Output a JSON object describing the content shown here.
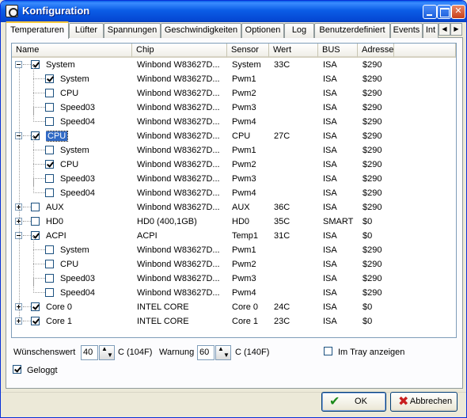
{
  "window": {
    "title": "Konfiguration"
  },
  "tabs": [
    {
      "label": "Temperaturen",
      "active": true
    },
    {
      "label": "Lüfter"
    },
    {
      "label": "Spannungen"
    },
    {
      "label": "Geschwindigkeiten"
    },
    {
      "label": "Optionen"
    },
    {
      "label": "Log"
    },
    {
      "label": "Benutzerdefiniert"
    },
    {
      "label": "Events"
    },
    {
      "label": "Int"
    }
  ],
  "table": {
    "columns": [
      "Name",
      "Chip",
      "Sensor",
      "Wert",
      "BUS",
      "Adresse"
    ],
    "rows": [
      {
        "level": 0,
        "expander": "minus",
        "checked": true,
        "name": "System",
        "chip": "Winbond W83627D...",
        "sensor": "System",
        "wert": "33C",
        "bus": "ISA",
        "adresse": "$290"
      },
      {
        "level": 1,
        "checked": true,
        "name": "System",
        "chip": "Winbond W83627D...",
        "sensor": "Pwm1",
        "wert": "",
        "bus": "ISA",
        "adresse": "$290"
      },
      {
        "level": 1,
        "checked": false,
        "name": "CPU",
        "chip": "Winbond W83627D...",
        "sensor": "Pwm2",
        "wert": "",
        "bus": "ISA",
        "adresse": "$290"
      },
      {
        "level": 1,
        "checked": false,
        "name": "Speed03",
        "chip": "Winbond W83627D...",
        "sensor": "Pwm3",
        "wert": "",
        "bus": "ISA",
        "adresse": "$290"
      },
      {
        "level": 1,
        "checked": false,
        "name": "Speed04",
        "chip": "Winbond W83627D...",
        "sensor": "Pwm4",
        "wert": "",
        "bus": "ISA",
        "adresse": "$290",
        "last": true
      },
      {
        "level": 0,
        "expander": "minus",
        "checked": true,
        "name": "CPU",
        "selected": true,
        "chip": "Winbond W83627D...",
        "sensor": "CPU",
        "wert": "27C",
        "bus": "ISA",
        "adresse": "$290"
      },
      {
        "level": 1,
        "checked": false,
        "name": "System",
        "chip": "Winbond W83627D...",
        "sensor": "Pwm1",
        "wert": "",
        "bus": "ISA",
        "adresse": "$290"
      },
      {
        "level": 1,
        "checked": true,
        "name": "CPU",
        "chip": "Winbond W83627D...",
        "sensor": "Pwm2",
        "wert": "",
        "bus": "ISA",
        "adresse": "$290"
      },
      {
        "level": 1,
        "checked": false,
        "name": "Speed03",
        "chip": "Winbond W83627D...",
        "sensor": "Pwm3",
        "wert": "",
        "bus": "ISA",
        "adresse": "$290"
      },
      {
        "level": 1,
        "checked": false,
        "name": "Speed04",
        "chip": "Winbond W83627D...",
        "sensor": "Pwm4",
        "wert": "",
        "bus": "ISA",
        "adresse": "$290",
        "last": true
      },
      {
        "level": 0,
        "expander": "plus",
        "checked": false,
        "name": "AUX",
        "chip": "Winbond W83627D...",
        "sensor": "AUX",
        "wert": "36C",
        "bus": "ISA",
        "adresse": "$290"
      },
      {
        "level": 0,
        "expander": "plus",
        "checked": false,
        "name": "HD0",
        "chip": "HD0 (400,1GB)",
        "sensor": "HD0",
        "wert": "35C",
        "bus": "SMART",
        "adresse": "$0"
      },
      {
        "level": 0,
        "expander": "minus",
        "checked": true,
        "name": "ACPI",
        "chip": "ACPI",
        "sensor": "Temp1",
        "wert": "31C",
        "bus": "ISA",
        "adresse": "$0"
      },
      {
        "level": 1,
        "checked": false,
        "name": "System",
        "chip": "Winbond W83627D...",
        "sensor": "Pwm1",
        "wert": "",
        "bus": "ISA",
        "adresse": "$290"
      },
      {
        "level": 1,
        "checked": false,
        "name": "CPU",
        "chip": "Winbond W83627D...",
        "sensor": "Pwm2",
        "wert": "",
        "bus": "ISA",
        "adresse": "$290"
      },
      {
        "level": 1,
        "checked": false,
        "name": "Speed03",
        "chip": "Winbond W83627D...",
        "sensor": "Pwm3",
        "wert": "",
        "bus": "ISA",
        "adresse": "$290"
      },
      {
        "level": 1,
        "checked": false,
        "name": "Speed04",
        "chip": "Winbond W83627D...",
        "sensor": "Pwm4",
        "wert": "",
        "bus": "ISA",
        "adresse": "$290",
        "last": true
      },
      {
        "level": 0,
        "expander": "plus",
        "checked": true,
        "name": "Core 0",
        "chip": "INTEL CORE",
        "sensor": "Core 0",
        "wert": "24C",
        "bus": "ISA",
        "adresse": "$0"
      },
      {
        "level": 0,
        "expander": "plus",
        "checked": true,
        "name": "Core 1",
        "chip": "INTEL CORE",
        "sensor": "Core 1",
        "wert": "23C",
        "bus": "ISA",
        "adresse": "$0",
        "lastRoot": true
      }
    ]
  },
  "controls": {
    "wunsch_label": "Wünschenswert",
    "wunsch_value": "40",
    "wunsch_unit": "C (104F)",
    "warnung_label": "Warnung",
    "warnung_value": "60",
    "warnung_unit": "C (140F)",
    "tray_label": "Im Tray anzeigen",
    "tray_checked": false,
    "geloggt_label": "Geloggt",
    "geloggt_checked": true
  },
  "buttons": {
    "ok": "OK",
    "cancel": "Abbrechen"
  }
}
